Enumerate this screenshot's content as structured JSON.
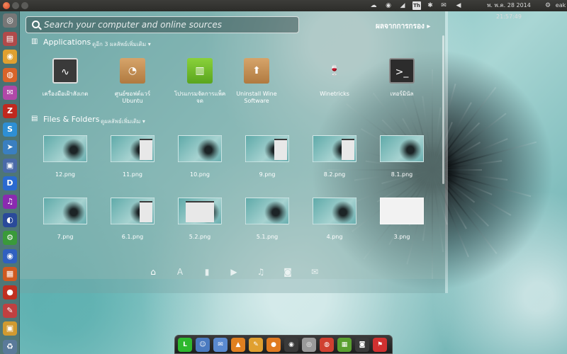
{
  "top_panel": {
    "clock": "พ. พ.ค. 28 2014 21:57:49",
    "user": "eak",
    "keyboard_layout": "Th"
  },
  "dash": {
    "search": {
      "placeholder": "Search your computer and online sources"
    },
    "filter_label": "ผลจากการกรอง ▸",
    "applications": {
      "title": "Applications",
      "more": "ดูอีก 3 ผลลัพธ์เพิ่มเติม ▾",
      "items": [
        {
          "label": "เครื่องมือเฝ้าสังเกต",
          "icon": "system-monitor-icon"
        },
        {
          "label": "ศูนย์ซอฟต์แวร์ Ubuntu",
          "icon": "software-center-icon"
        },
        {
          "label": "โปรแกรมจัดการแพ็คจด",
          "icon": "package-manager-icon"
        },
        {
          "label": "Uninstall Wine Software",
          "icon": "uninstall-wine-icon"
        },
        {
          "label": "Winetricks",
          "icon": "winetricks-icon"
        },
        {
          "label": "เทอร์มินัล",
          "icon": "terminal-icon"
        }
      ]
    },
    "files": {
      "title": "Files & Folders",
      "more": "ดูผลลัพธ์เพิ่มเติม ▾",
      "items": [
        {
          "label": "12.png"
        },
        {
          "label": "11.png"
        },
        {
          "label": "10.png"
        },
        {
          "label": "9.png"
        },
        {
          "label": "8.2.png"
        },
        {
          "label": "8.1.png"
        },
        {
          "label": "7.png"
        },
        {
          "label": "6.1.png"
        },
        {
          "label": "5.2.png"
        },
        {
          "label": "5.1.png"
        },
        {
          "label": "4.png"
        },
        {
          "label": "3.png"
        }
      ]
    },
    "lenses": [
      "home-lens-icon",
      "applications-lens-icon",
      "files-lens-icon",
      "video-lens-icon",
      "music-lens-icon",
      "photo-lens-icon",
      "social-lens-icon"
    ]
  },
  "launcher": {
    "items": [
      "dash-home-icon",
      "files-icon",
      "chrome-icon",
      "firefox-icon",
      "mail-icon",
      "filezilla-icon",
      "skype-icon",
      "telegram-icon",
      "screenshot-icon",
      "dropbox-icon",
      "headphones-icon",
      "disk-utility-icon",
      "settings-icon",
      "update-icon",
      "software-icon",
      "record-icon",
      "sketch-icon",
      "image-viewer-icon",
      "trash-icon"
    ]
  },
  "dock": {
    "items": [
      "line-icon",
      "finder-icon",
      "mail-icon",
      "vlc-icon",
      "pencil-icon",
      "browser-icon",
      "ball-icon",
      "disk-icon",
      "chrome-icon",
      "spreadsheet-icon",
      "camera-icon",
      "flag-icon"
    ]
  },
  "colors": {
    "accent": "#e05a2b",
    "panel": "#2c2c29"
  }
}
